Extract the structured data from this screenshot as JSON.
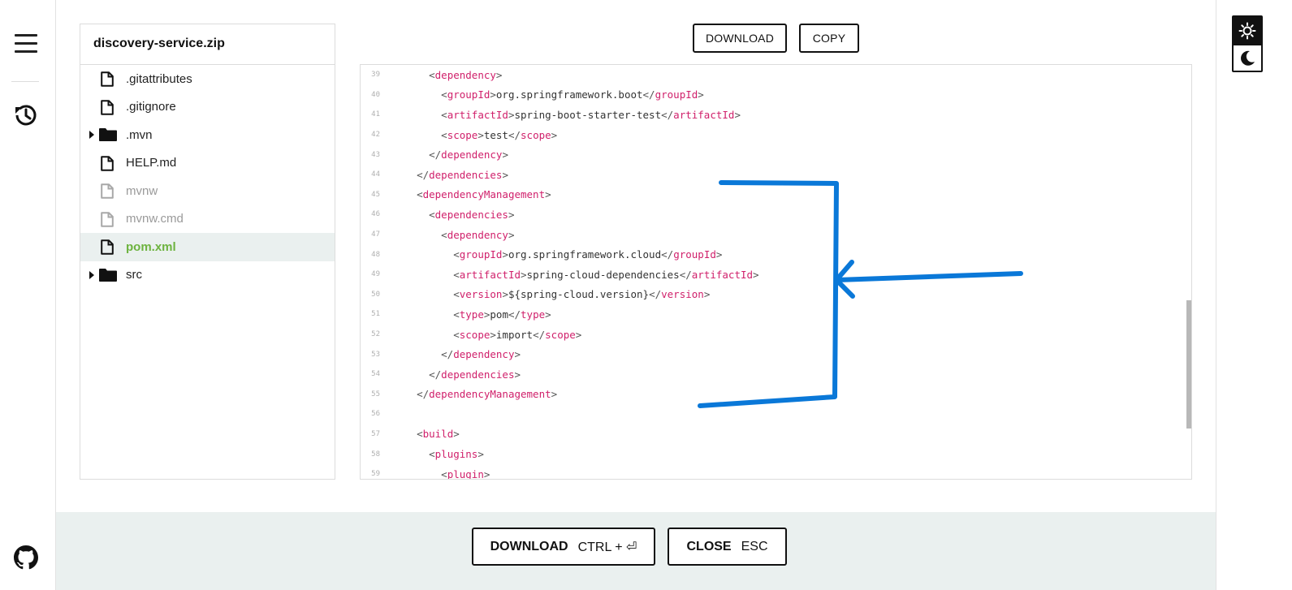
{
  "project": {
    "zip_name": "discovery-service.zip"
  },
  "files": [
    {
      "name": ".gitattributes",
      "type": "file",
      "state": "normal"
    },
    {
      "name": ".gitignore",
      "type": "file",
      "state": "normal"
    },
    {
      "name": ".mvn",
      "type": "folder",
      "state": "normal"
    },
    {
      "name": "HELP.md",
      "type": "file",
      "state": "normal"
    },
    {
      "name": "mvnw",
      "type": "file",
      "state": "dim"
    },
    {
      "name": "mvnw.cmd",
      "type": "file",
      "state": "dim"
    },
    {
      "name": "pom.xml",
      "type": "file",
      "state": "active"
    },
    {
      "name": "src",
      "type": "folder",
      "state": "normal"
    }
  ],
  "toolbar": {
    "download_label": "DOWNLOAD",
    "copy_label": "COPY"
  },
  "code": {
    "lines": [
      {
        "n": "39",
        "indent": 2,
        "kind": "open",
        "tag": "dependency"
      },
      {
        "n": "40",
        "indent": 3,
        "kind": "elem",
        "tag": "groupId",
        "text": "org.springframework.boot"
      },
      {
        "n": "41",
        "indent": 3,
        "kind": "elem",
        "tag": "artifactId",
        "text": "spring-boot-starter-test"
      },
      {
        "n": "42",
        "indent": 3,
        "kind": "elem",
        "tag": "scope",
        "text": "test"
      },
      {
        "n": "43",
        "indent": 2,
        "kind": "close",
        "tag": "dependency"
      },
      {
        "n": "44",
        "indent": 1,
        "kind": "close",
        "tag": "dependencies"
      },
      {
        "n": "45",
        "indent": 1,
        "kind": "open",
        "tag": "dependencyManagement"
      },
      {
        "n": "46",
        "indent": 2,
        "kind": "open",
        "tag": "dependencies"
      },
      {
        "n": "47",
        "indent": 3,
        "kind": "open",
        "tag": "dependency"
      },
      {
        "n": "48",
        "indent": 4,
        "kind": "elem",
        "tag": "groupId",
        "text": "org.springframework.cloud"
      },
      {
        "n": "49",
        "indent": 4,
        "kind": "elem",
        "tag": "artifactId",
        "text": "spring-cloud-dependencies"
      },
      {
        "n": "50",
        "indent": 4,
        "kind": "elem",
        "tag": "version",
        "text": "${spring-cloud.version}"
      },
      {
        "n": "51",
        "indent": 4,
        "kind": "elem",
        "tag": "type",
        "text": "pom"
      },
      {
        "n": "52",
        "indent": 4,
        "kind": "elem",
        "tag": "scope",
        "text": "import"
      },
      {
        "n": "53",
        "indent": 3,
        "kind": "close",
        "tag": "dependency"
      },
      {
        "n": "54",
        "indent": 2,
        "kind": "close",
        "tag": "dependencies"
      },
      {
        "n": "55",
        "indent": 1,
        "kind": "close",
        "tag": "dependencyManagement"
      },
      {
        "n": "56",
        "indent": 0,
        "kind": "blank"
      },
      {
        "n": "57",
        "indent": 1,
        "kind": "open",
        "tag": "build"
      },
      {
        "n": "58",
        "indent": 2,
        "kind": "open",
        "tag": "plugins"
      },
      {
        "n": "59",
        "indent": 3,
        "kind": "open",
        "tag": "plugin"
      }
    ]
  },
  "footer": {
    "download_label": "DOWNLOAD",
    "download_shortcut": "CTRL + ⏎",
    "close_label": "CLOSE",
    "close_shortcut": "ESC"
  },
  "colors": {
    "accent_green": "#6db33f",
    "xml_tag": "#d0206b",
    "annotation_blue": "#0a78d8"
  },
  "icons": [
    "menu-icon",
    "history-icon",
    "github-icon",
    "sun-icon",
    "moon-icon",
    "file-icon",
    "folder-icon"
  ]
}
